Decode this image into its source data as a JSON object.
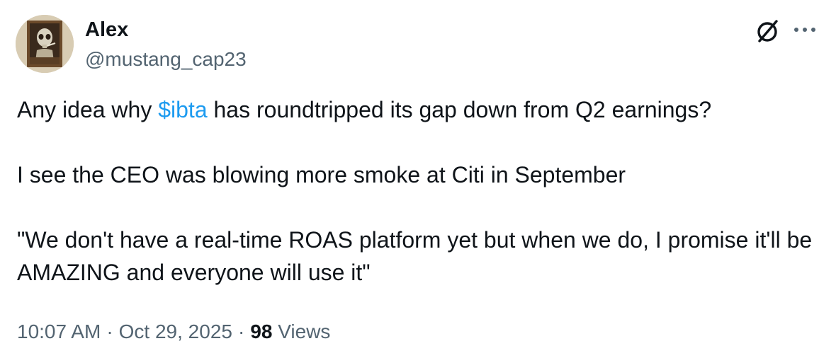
{
  "author": {
    "name": "Alex",
    "handle": "@mustang_cap23",
    "avatar_icon": "skeleton-painting-avatar"
  },
  "actions": {
    "grok_icon": "grok-slash-circle-icon",
    "more_icon": "more-dots-icon"
  },
  "tweet": {
    "line1_prefix": "Any idea why ",
    "cashtag": "$ibta",
    "line1_suffix": " has roundtripped its gap down from Q2 earnings?",
    "line2": "I see the CEO was blowing more smoke at Citi in September",
    "line3": "\"We don't have a real-time ROAS platform yet but when we do, I promise it'll be AMAZING and everyone will use it\""
  },
  "meta": {
    "time": "10:07 AM",
    "separator": "·",
    "date": "Oct 29, 2025",
    "views_count": "98",
    "views_label": "Views"
  },
  "colors": {
    "text": "#0f1419",
    "secondary": "#536471",
    "link": "#1d9bf0"
  }
}
